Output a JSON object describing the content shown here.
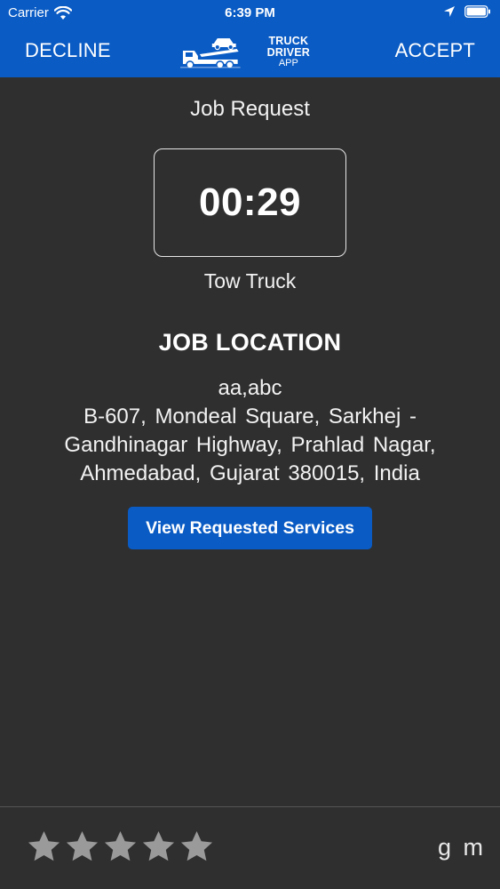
{
  "status_bar": {
    "carrier": "Carrier",
    "time": "6:39 PM"
  },
  "nav": {
    "decline_label": "DECLINE",
    "accept_label": "ACCEPT",
    "logo_line1": "TRUCK DRIVER",
    "logo_line2": "APP"
  },
  "job": {
    "title": "Job Request",
    "timer": "00:29",
    "vehicle_type": "Tow Truck",
    "location_heading": "JOB LOCATION",
    "address_name": "aa,abc",
    "address": "B-607, Mondeal Square, Sarkhej - Gandhinagar Highway, Prahlad Nagar, Ahmedabad, Gujarat 380015, India",
    "view_services_label": "View Requested Services"
  },
  "footer": {
    "rating": 0,
    "max_rating": 5,
    "user_name": "g m"
  },
  "colors": {
    "brand_blue": "#0a5bc4",
    "background": "#2f2f2f",
    "star_empty": "#9a9a9a"
  },
  "icons": [
    "wifi-icon",
    "location-arrow-icon",
    "battery-icon",
    "truck-logo-icon",
    "star-icon"
  ]
}
